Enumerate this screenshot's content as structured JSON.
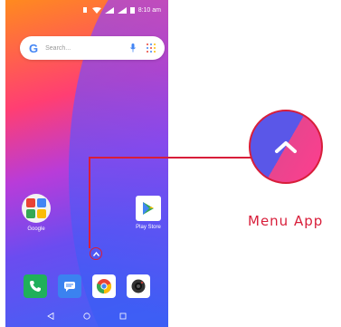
{
  "status_bar": {
    "time": "8:10 am"
  },
  "search": {
    "logo": "G",
    "placeholder": "Search..."
  },
  "apps": {
    "google_folder": {
      "label": "Google"
    },
    "play_store": {
      "label": "Play Store"
    }
  },
  "dock": [
    "phone-icon",
    "messages-icon",
    "chrome-icon",
    "camera-icon"
  ],
  "callout": {
    "label": "Menu App"
  },
  "colors": {
    "accent": "#d81e3a",
    "zoom_left": "#5a57e8",
    "zoom_right": "#ff3e8e"
  }
}
